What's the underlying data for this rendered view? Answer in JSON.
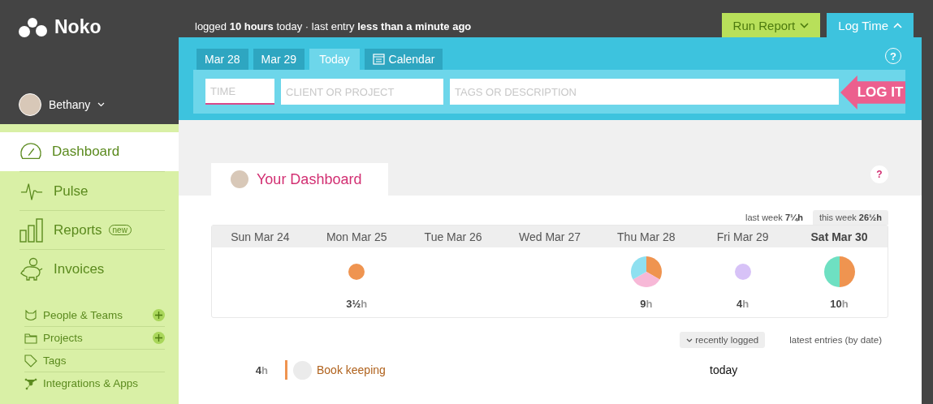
{
  "app": {
    "logo": "Noko"
  },
  "status": {
    "text": "logged **10 hours** today · last entry **less than a minute ago**"
  },
  "header_buttons": [
    {
      "label": "Run Report",
      "kind": "report",
      "expanded": false
    },
    {
      "label": "Log Time",
      "kind": "log",
      "expanded": true
    }
  ],
  "user": {
    "name": "Bethany"
  },
  "sidebar": {
    "items": [
      {
        "label": "Dashboard",
        "selected": true
      },
      {
        "label": "Pulse",
        "selected": false
      },
      {
        "label": "Reports",
        "selected": false,
        "badge": "new"
      },
      {
        "label": "Invoices",
        "selected": false
      }
    ],
    "secondary_items": [
      {
        "label": "People & Teams",
        "addable": true
      },
      {
        "label": "Projects",
        "addable": true
      },
      {
        "label": "Tags",
        "addable": false
      },
      {
        "label": "Integrations & Apps",
        "addable": false
      }
    ]
  },
  "entry": {
    "tabs": [
      {
        "label": "Mar 28",
        "kind": "date",
        "selected": false
      },
      {
        "label": "Mar 29",
        "kind": "date",
        "selected": false
      },
      {
        "label": "Today",
        "kind": "date",
        "selected": true
      },
      {
        "label": "Calendar",
        "kind": "calendar",
        "selected": false
      }
    ],
    "help": "?",
    "fields": [
      {
        "placeholder": "TIME",
        "kind": "time",
        "focused": true
      },
      {
        "placeholder": "CLIENT OR PROJECT",
        "kind": "project",
        "focused": false
      },
      {
        "placeholder": "TAGS OR DESCRIPTION",
        "kind": "description",
        "focused": false
      }
    ],
    "submit": "LOG IT"
  },
  "dashboard": {
    "tab": "Your Dashboard",
    "help": "?",
    "totals": [
      {
        "label": "last week",
        "value": "7¼h",
        "selected": false
      },
      {
        "label": "this week",
        "value": "26½h",
        "selected": true
      }
    ],
    "days": [
      {
        "label": "Sun Mar 24",
        "selected": false
      },
      {
        "label": "Mon Mar 25",
        "selected": false,
        "hours": "3½",
        "unit": "h",
        "slices": [
          {
            "color": "#ef9450"
          }
        ]
      },
      {
        "label": "Tue Mar 26",
        "selected": false
      },
      {
        "label": "Wed Mar 27",
        "selected": false
      },
      {
        "label": "Thu Mar 28",
        "selected": false,
        "hours": "9",
        "unit": "h",
        "slices": [
          {
            "color": "#ef9450"
          },
          {
            "color": "#f7b8d7"
          },
          {
            "color": "#8fe0f0"
          }
        ]
      },
      {
        "label": "Fri Mar 29",
        "selected": false,
        "hours": "4",
        "unit": "h",
        "slices": [
          {
            "color": "#d7c2f7"
          }
        ]
      },
      {
        "label": "Sat Mar 30",
        "selected": true,
        "hours": "10",
        "unit": "h",
        "slices": [
          {
            "color": "#ef9450"
          },
          {
            "color": "#6ee0c2"
          }
        ]
      }
    ],
    "sort": [
      {
        "label": "recently logged",
        "selected": true
      },
      {
        "label": "latest entries (by date)",
        "selected": false
      }
    ],
    "entries": [
      {
        "hours": "4",
        "unit": "h",
        "project": "Book keeping",
        "color": "#ef9450",
        "date": "today"
      }
    ]
  }
}
